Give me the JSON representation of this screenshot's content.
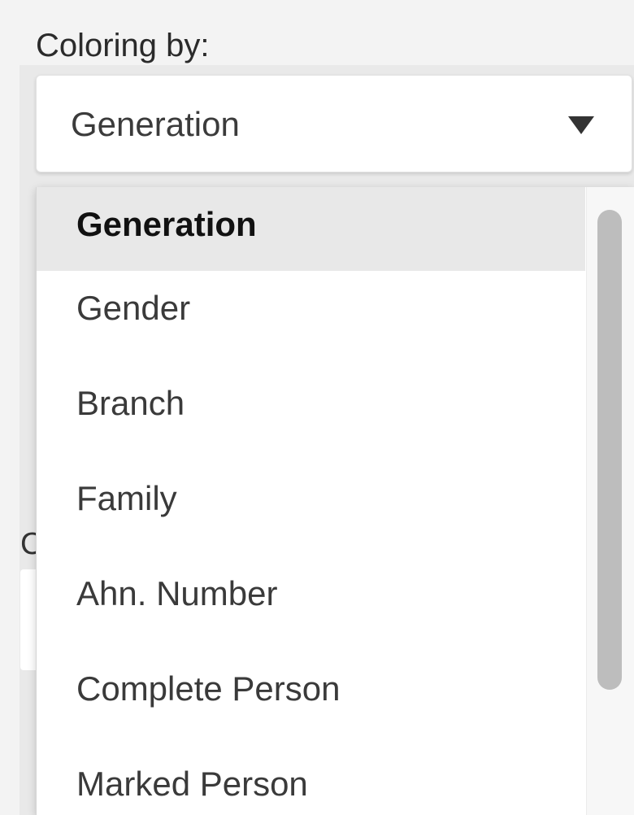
{
  "panel": {
    "label": "Coloring by:",
    "behind_label_fragment": "C"
  },
  "select": {
    "value": "Generation",
    "caret_icon": "triangle-down-icon"
  },
  "dropdown": {
    "options": [
      "Generation",
      "Gender",
      "Branch",
      "Family",
      "Ahn. Number",
      "Complete Person",
      "Marked Person"
    ],
    "selected_index": 0,
    "scroll_position": 0.0
  },
  "colors": {
    "page_bg": "#f3f3f3",
    "dropdown_bg": "#ffffff",
    "selected_option_bg": "#e8e8e8",
    "scrollbar_thumb": "#bdbdbd"
  }
}
